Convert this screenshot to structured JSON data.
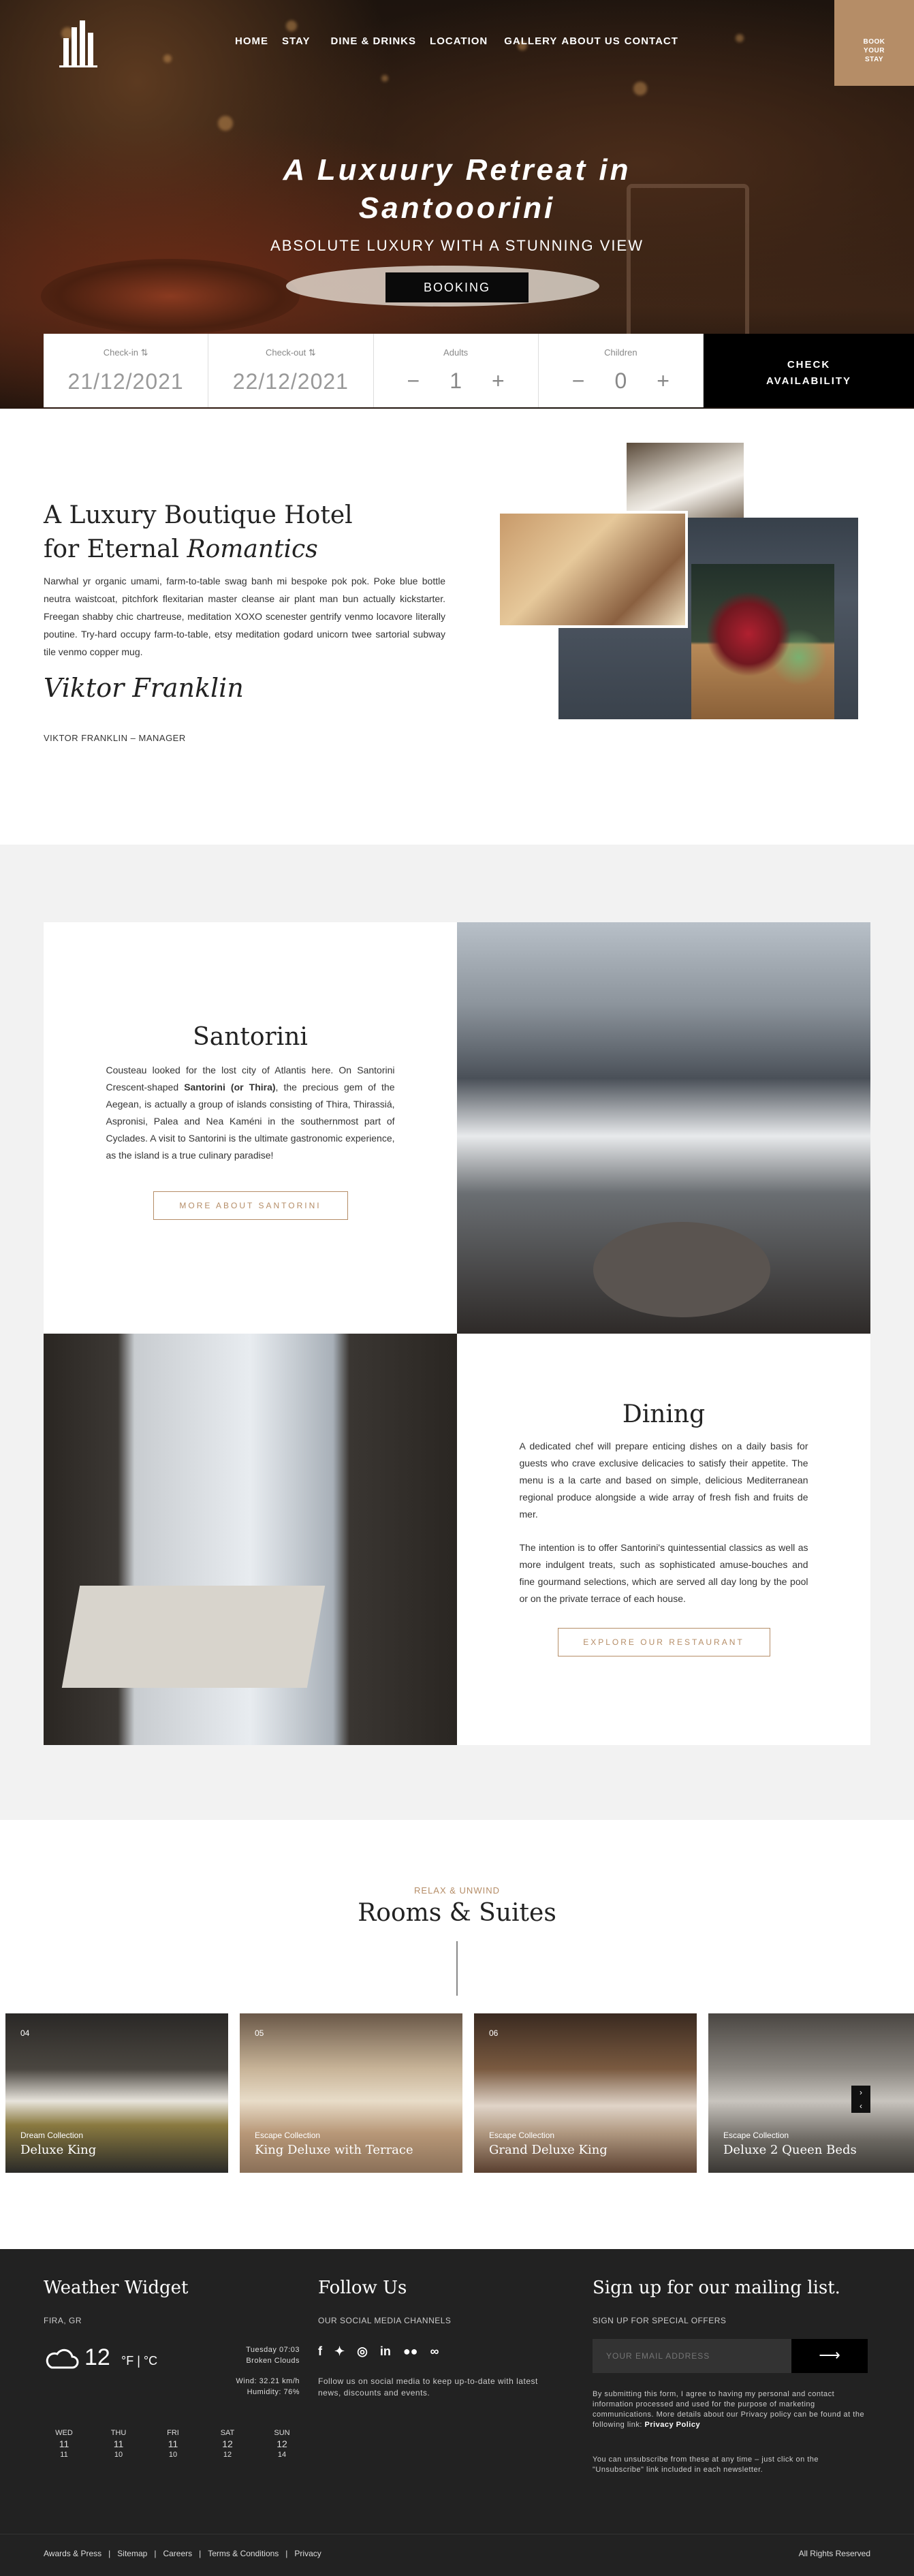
{
  "nav": {
    "items": [
      "HOME",
      "STAY",
      "DINE & DRINKS",
      "LOCATION",
      "GALLERY",
      "ABOUT US",
      "CONTACT"
    ],
    "book_stay": [
      "BOOK",
      "YOUR",
      "STAY"
    ]
  },
  "hero": {
    "title_line1": "A Luxuury Retreat in",
    "title_line2": "Santooorini",
    "subtitle": "ABSOLUTE LUXURY WITH A STUNNING VIEW",
    "booking": "BOOKING"
  },
  "availability": {
    "checkin_label": "Check-in",
    "checkin_value": "21/12/2021",
    "checkout_label": "Check-out",
    "checkout_value": "22/12/2021",
    "adults_label": "Adults",
    "adults_value": "1",
    "children_label": "Children",
    "children_value": "0",
    "minus": "−",
    "plus": "+",
    "check_line1": "CHECK",
    "check_line2": "AVAILABILITY"
  },
  "intro": {
    "title_line1": "A Luxury Boutique Hotel",
    "title_line2": "for Eternal ",
    "title_italic": "Romantics",
    "text": "Narwhal yr organic umami, farm-to-table swag banh mi bespoke pok pok. Poke blue bottle neutra waistcoat, pitchfork flexitarian master cleanse air plant man bun actually kickstarter. Freegan shabby chic chartreuse, meditation XOXO scenester gentrify venmo locavore literally poutine. Try-hard occupy farm-to-table, etsy meditation godard unicorn twee sartorial subway tile venmo copper mug.",
    "signature": "Viktor Franklin",
    "manager": "VIKTOR FRANKLIN – MANAGER"
  },
  "santorini": {
    "title": "Santorini",
    "text_before": "Cousteau looked for the lost city of Atlantis here. On Santorini Crescent-shaped ",
    "text_bold": "Santorini (or Thira)",
    "text_after": ", the precious gem of the Aegean, is actually a group of islands consisting of Thira, Thirassiá, Aspronisi, Palea and Nea Kaméni in the southernmost part of Cyclades. A visit to Santorini is the ultimate gastronomic experience, as the island is a true culinary paradise!",
    "button": "MORE ABOUT SANTORINI"
  },
  "dining": {
    "title": "Dining",
    "p1": "A dedicated chef will prepare enticing dishes on a daily basis for guests who crave exclusive delicacies to satisfy their appetite. The menu is a la carte and based on simple, delicious Mediterranean regional produce alongside a wide array of fresh fish and fruits de mer.",
    "p2": "The intention is to offer Santorini's quintessential classics as well as more indulgent treats, such as sophisticated amuse-bouches and fine gourmand selections, which are served all day long by the pool or on the private terrace of each house.",
    "button": "EXPLORE OUR RESTAURANT"
  },
  "rooms": {
    "kicker": "RELAX & UNWIND",
    "title": "Rooms & Suites",
    "cards": [
      {
        "num": "04",
        "collection": "Dream Collection",
        "name": "Deluxe King"
      },
      {
        "num": "05",
        "collection": "Escape Collection",
        "name": "King Deluxe with Terrace"
      },
      {
        "num": "06",
        "collection": "Escape Collection",
        "name": "Grand Deluxe King"
      },
      {
        "num": "",
        "collection": "Escape Collection",
        "name": "Deluxe 2 Queen Beds"
      }
    ]
  },
  "weather": {
    "title": "Weather Widget",
    "location": "FIRA, GR",
    "temp": "12",
    "units": "°F | °C",
    "date": "Tuesday 07:03",
    "condition": "Broken Clouds",
    "wind": "Wind: 32.21 km/h",
    "humidity": "Humidity: 76%",
    "days": [
      {
        "d": "WED",
        "t": "11",
        "l": "11"
      },
      {
        "d": "THU",
        "t": "11",
        "l": "10"
      },
      {
        "d": "FRI",
        "t": "11",
        "l": "10"
      },
      {
        "d": "SAT",
        "t": "12",
        "l": "12"
      },
      {
        "d": "SUN",
        "t": "12",
        "l": "14"
      }
    ]
  },
  "social": {
    "title": "Follow Us",
    "label": "OUR SOCIAL MEDIA CHANNELS",
    "text": "Follow us on social media to keep up-to-date with latest news, discounts and events."
  },
  "mailing": {
    "title": "Sign up for our mailing list.",
    "label": "SIGN UP FOR SPECIAL OFFERS",
    "placeholder": "YOUR EMAIL ADDRESS",
    "consent": "By submitting this form, I agree to having my personal and contact information processed and used for the purpose of marketing communications. More details about our Privacy policy can be found at the following link: ",
    "privacy": "Privacy Policy",
    "unsub": "You can unsubscribe from these at any time – just click on the \"Unsubscribe\" link included in each newsletter."
  },
  "footer": {
    "links": [
      "Awards & Press",
      "Sitemap",
      "Careers",
      "Terms & Conditions",
      "Privacy"
    ],
    "rights": "All Rights Reserved"
  }
}
